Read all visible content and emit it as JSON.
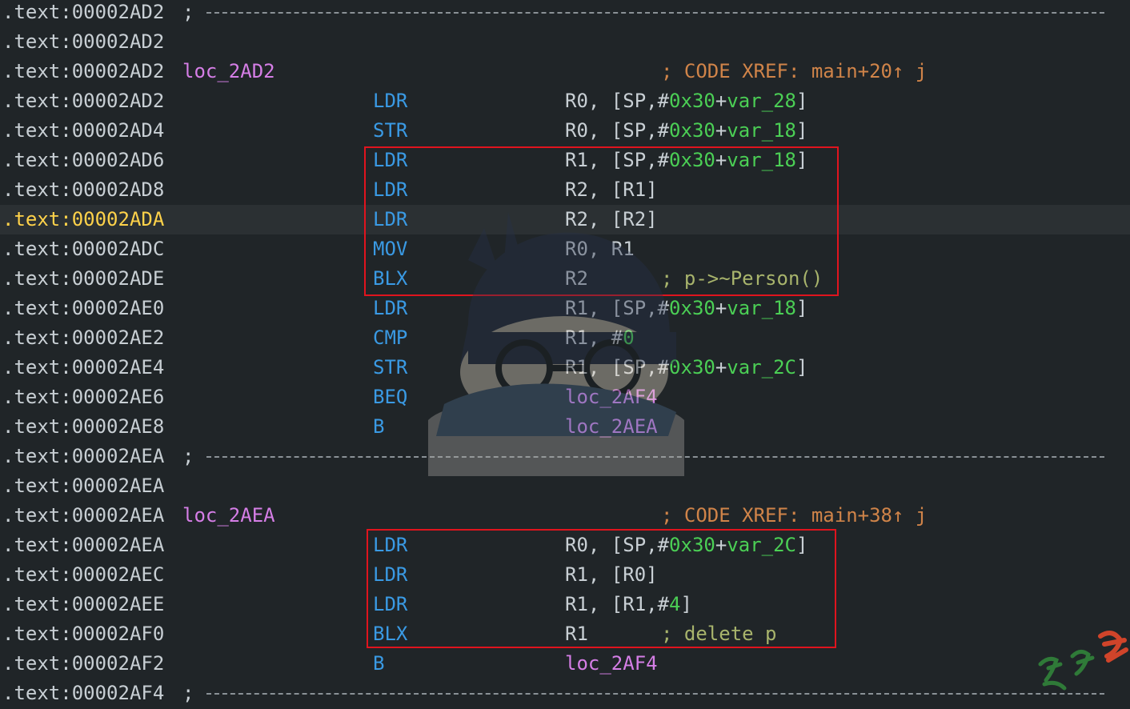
{
  "rows": [
    {
      "addr": ".text:00002AD2",
      "type": "sep"
    },
    {
      "addr": ".text:00002AD2",
      "type": "blank"
    },
    {
      "addr": ".text:00002AD2",
      "type": "label",
      "label": "loc_2AD2",
      "comment": "; CODE XREF: main+20↑ j"
    },
    {
      "addr": ".text:00002AD2",
      "type": "ins",
      "mnem": "LDR",
      "operands": [
        [
          "reg",
          "R0, ["
        ],
        [
          "reg",
          "SP,#"
        ],
        [
          "num",
          "0x30"
        ],
        [
          "reg",
          "+"
        ],
        [
          "var",
          "var_28"
        ],
        [
          "reg",
          "]"
        ]
      ]
    },
    {
      "addr": ".text:00002AD4",
      "type": "ins",
      "mnem": "STR",
      "operands": [
        [
          "reg",
          "R0, ["
        ],
        [
          "reg",
          "SP,#"
        ],
        [
          "num",
          "0x30"
        ],
        [
          "reg",
          "+"
        ],
        [
          "var",
          "var_18"
        ],
        [
          "reg",
          "]"
        ]
      ]
    },
    {
      "addr": ".text:00002AD6",
      "type": "ins",
      "mnem": "LDR",
      "operands": [
        [
          "reg",
          "R1, ["
        ],
        [
          "reg",
          "SP,#"
        ],
        [
          "num",
          "0x30"
        ],
        [
          "reg",
          "+"
        ],
        [
          "var",
          "var_18"
        ],
        [
          "reg",
          "]"
        ]
      ]
    },
    {
      "addr": ".text:00002AD8",
      "type": "ins",
      "mnem": "LDR",
      "operands": [
        [
          "reg",
          "R2, [R1]"
        ]
      ]
    },
    {
      "addr": ".text:00002ADA",
      "type": "ins",
      "mnem": "LDR",
      "operands": [
        [
          "reg",
          "R2, [R2]"
        ]
      ],
      "current": true
    },
    {
      "addr": ".text:00002ADC",
      "type": "ins",
      "mnem": "MOV",
      "operands": [
        [
          "reg",
          "R0, R1"
        ]
      ]
    },
    {
      "addr": ".text:00002ADE",
      "type": "ins",
      "mnem": "BLX",
      "operands": [
        [
          "reg",
          "R2"
        ]
      ],
      "comment": "; p->~Person()"
    },
    {
      "addr": ".text:00002AE0",
      "type": "ins",
      "mnem": "LDR",
      "operands": [
        [
          "reg",
          "R1, ["
        ],
        [
          "reg",
          "SP,#"
        ],
        [
          "num",
          "0x30"
        ],
        [
          "reg",
          "+"
        ],
        [
          "var",
          "var_18"
        ],
        [
          "reg",
          "]"
        ]
      ]
    },
    {
      "addr": ".text:00002AE2",
      "type": "ins",
      "mnem": "CMP",
      "operands": [
        [
          "reg",
          "R1, #"
        ],
        [
          "num",
          "0"
        ]
      ]
    },
    {
      "addr": ".text:00002AE4",
      "type": "ins",
      "mnem": "STR",
      "operands": [
        [
          "reg",
          "R1, ["
        ],
        [
          "reg",
          "SP,#"
        ],
        [
          "num",
          "0x30"
        ],
        [
          "reg",
          "+"
        ],
        [
          "var",
          "var_2C"
        ],
        [
          "reg",
          "]"
        ]
      ]
    },
    {
      "addr": ".text:00002AE6",
      "type": "ins",
      "mnem": "BEQ",
      "operands": [
        [
          "loc",
          "loc_2AF4"
        ]
      ]
    },
    {
      "addr": ".text:00002AE8",
      "type": "ins",
      "mnem": "B",
      "operands": [
        [
          "loc",
          "loc_2AEA"
        ]
      ]
    },
    {
      "addr": ".text:00002AEA",
      "type": "sep"
    },
    {
      "addr": ".text:00002AEA",
      "type": "blank"
    },
    {
      "addr": ".text:00002AEA",
      "type": "label",
      "label": "loc_2AEA",
      "comment": "; CODE XREF: main+38↑ j"
    },
    {
      "addr": ".text:00002AEA",
      "type": "ins",
      "mnem": "LDR",
      "operands": [
        [
          "reg",
          "R0, ["
        ],
        [
          "reg",
          "SP,#"
        ],
        [
          "num",
          "0x30"
        ],
        [
          "reg",
          "+"
        ],
        [
          "var",
          "var_2C"
        ],
        [
          "reg",
          "]"
        ]
      ]
    },
    {
      "addr": ".text:00002AEC",
      "type": "ins",
      "mnem": "LDR",
      "operands": [
        [
          "reg",
          "R1, [R0]"
        ]
      ]
    },
    {
      "addr": ".text:00002AEE",
      "type": "ins",
      "mnem": "LDR",
      "operands": [
        [
          "reg",
          "R1, [R1,#"
        ],
        [
          "num",
          "4"
        ],
        [
          "reg",
          "]"
        ]
      ]
    },
    {
      "addr": ".text:00002AF0",
      "type": "ins",
      "mnem": "BLX",
      "operands": [
        [
          "reg",
          "R1"
        ]
      ],
      "comment": "; delete p"
    },
    {
      "addr": ".text:00002AF2",
      "type": "ins",
      "mnem": "B",
      "operands": [
        [
          "loc",
          "loc_2AF4"
        ]
      ]
    },
    {
      "addr": ".text:00002AF4",
      "type": "sep"
    }
  ],
  "colors": {
    "background": "#202528",
    "address": "#c8cfd4",
    "current_address": "#ffd24a",
    "mnemonic": "#3a9ae4",
    "label": "#d57ee6",
    "number": "#4bcf55",
    "xref_comment": "#d08449",
    "user_comment": "#a8b46c",
    "highlight_box": "#e0141e"
  },
  "watermark": {
    "icon": "anime-character-sleeping-watermark-icon"
  },
  "corner_logo": {
    "icon": "calligraphy-stamp-icon"
  }
}
